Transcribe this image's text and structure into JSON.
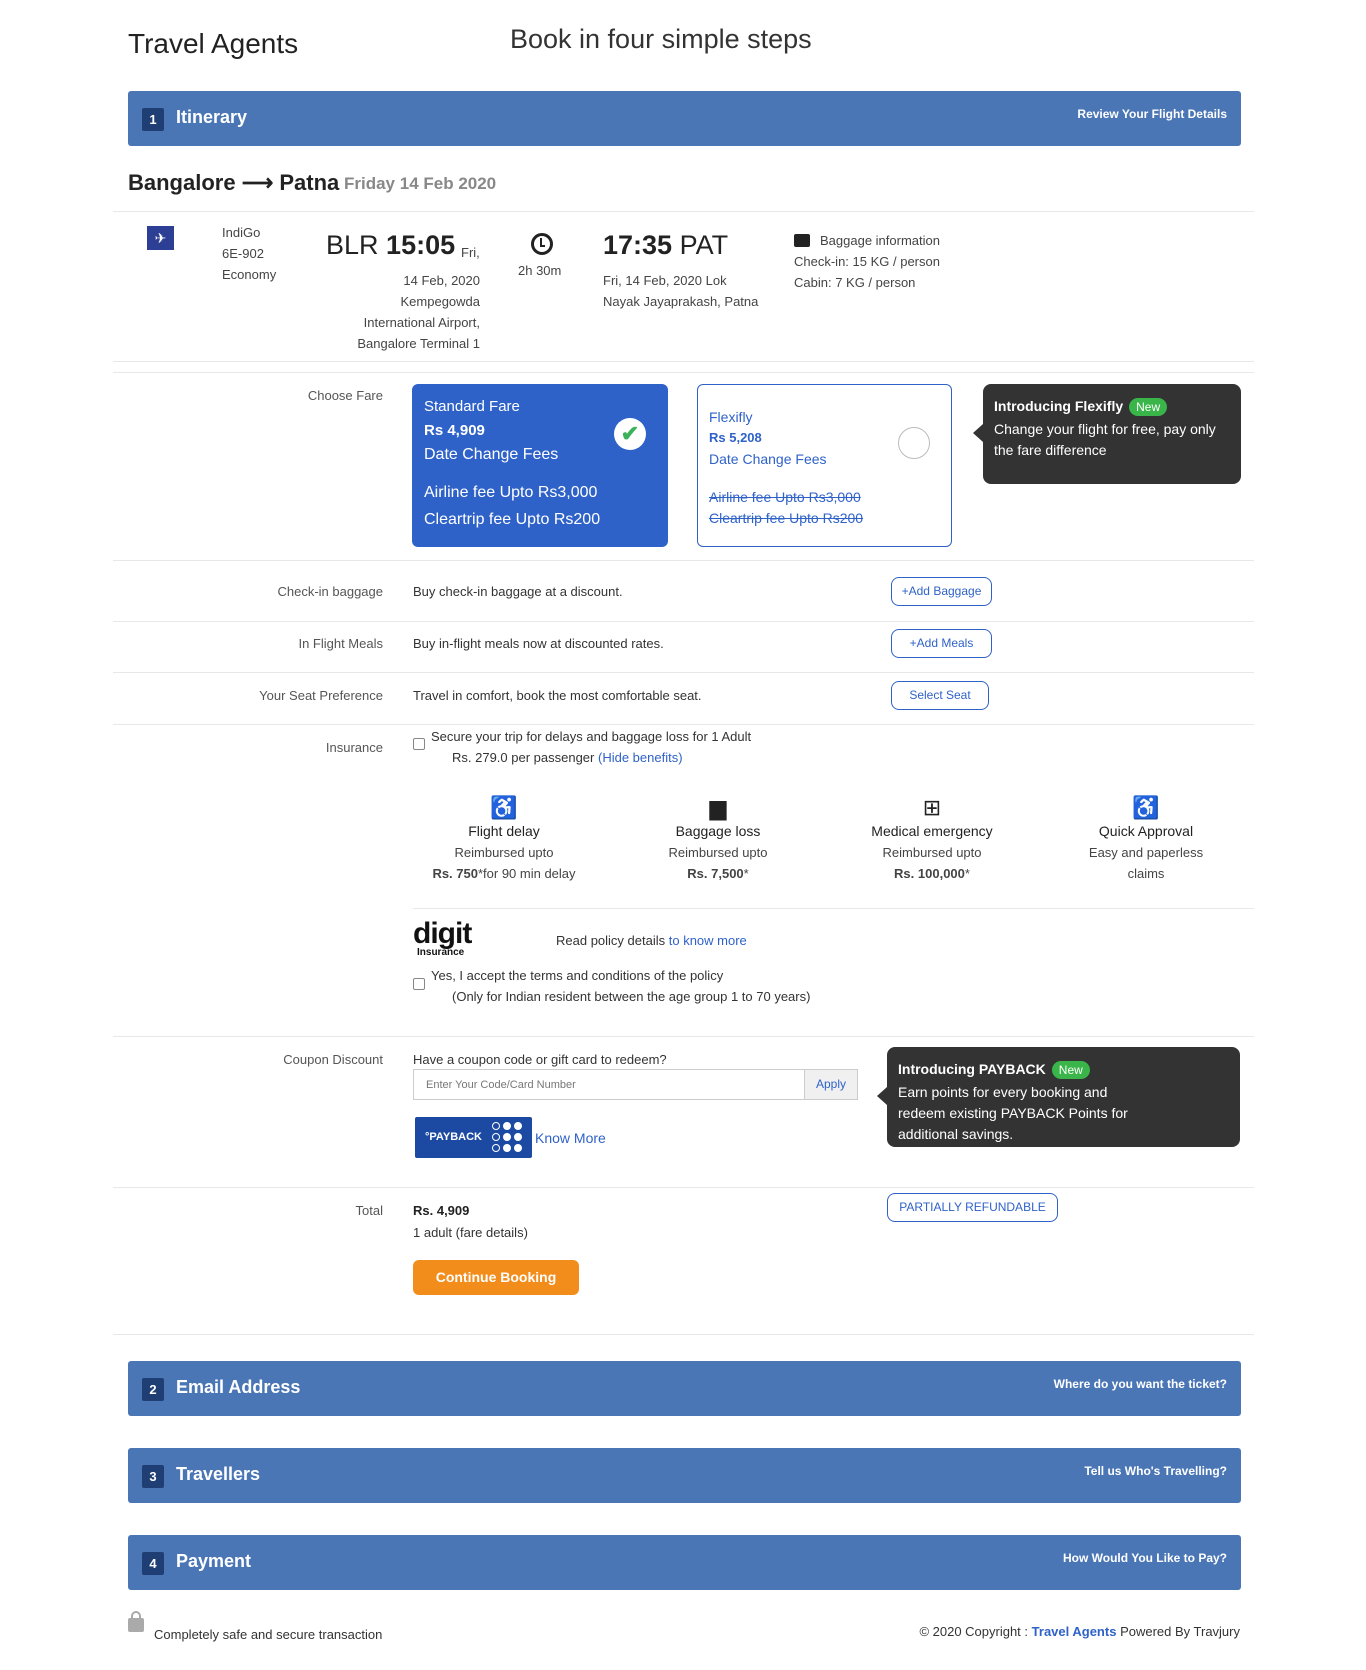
{
  "header": {
    "logo": "Travel Agents",
    "tagline": "Book in four simple steps"
  },
  "steps": [
    {
      "num": "1",
      "title": "Itinerary",
      "sub": "Review Your Flight Details"
    },
    {
      "num": "2",
      "title": "Email Address",
      "sub": "Where do you want the ticket?"
    },
    {
      "num": "3",
      "title": "Travellers",
      "sub": "Tell us Who's Travelling?"
    },
    {
      "num": "4",
      "title": "Payment",
      "sub": "How Would You Like to Pay?"
    }
  ],
  "itinerary": {
    "route": "Bangalore ⟶ Patna",
    "date": "Friday 14 Feb 2020",
    "airline": "IndiGo",
    "flight_no": "6E-902",
    "cabin": "Economy",
    "dep_code": "BLR",
    "dep_time": "15:05",
    "dep_day": "Fri,",
    "dep_detail_1": "14 Feb, 2020",
    "dep_detail_2": "Kempegowda",
    "dep_detail_3": "International Airport,",
    "dep_detail_4": "Bangalore Terminal 1",
    "duration": "2h 30m",
    "arr_time": "17:35",
    "arr_code": "PAT",
    "arr_detail_1": "Fri, 14 Feb, 2020 Lok",
    "arr_detail_2": "Nayak Jayaprakash, Patna",
    "baggage_title": "Baggage information",
    "checkin": "Check-in: 15 KG / person",
    "cabin_bag": "Cabin: 7 KG / person"
  },
  "fare": {
    "label": "Choose Fare",
    "standard": {
      "name": "Standard Fare",
      "price": "Rs 4,909",
      "desc": "Date Change Fees",
      "airline_fee": "Airline fee Upto Rs3,000",
      "cleartrip_fee": "Cleartrip fee Upto Rs200"
    },
    "flexifly": {
      "name": "Flexifly",
      "price": "Rs 5,208",
      "desc": "Date Change Fees",
      "airline_fee": "Airline fee Upto Rs3,000",
      "cleartrip_fee": "Cleartrip fee Upto Rs200"
    },
    "tip_title": "Introducing Flexifly",
    "tip_badge": "New",
    "tip_text": "Change your flight for free, pay only the fare difference"
  },
  "addons": {
    "baggage_label": "Check-in baggage",
    "baggage_text": "Buy check-in baggage at a discount.",
    "baggage_btn": "+Add Baggage",
    "meals_label": "In Flight Meals",
    "meals_text": "Buy in-flight meals now at discounted rates.",
    "meals_btn": "+Add Meals",
    "seat_label": "Your Seat Preference",
    "seat_text": "Travel in comfort, book the most comfortable seat.",
    "seat_btn": "Select Seat"
  },
  "insurance": {
    "label": "Insurance",
    "line1": "Secure your trip for delays and baggage loss for 1 Adult",
    "line2": "Rs. 279.0 per passenger",
    "hide_link": "(Hide benefits)",
    "benefits": [
      {
        "icon": "wheelchair-icon",
        "title": "Flight delay",
        "l1": "Reimbursed upto",
        "l2b": "Rs. 750",
        "l2": "*for 90 min delay"
      },
      {
        "icon": "suitcase-icon",
        "title": "Baggage loss",
        "l1": "Reimbursed upto",
        "l2b": "Rs. 7,500",
        "l2": "*"
      },
      {
        "icon": "medical-kit-icon",
        "title": "Medical emergency",
        "l1": "Reimbursed upto",
        "l2b": "Rs. 100,000",
        "l2": "*"
      },
      {
        "icon": "wheelchair-icon",
        "title": "Quick Approval",
        "l1": "Easy and paperless",
        "l2b": "",
        "l2": "claims"
      }
    ],
    "brand": "digit",
    "brand_sub": "Insurance",
    "policy_text": "Read policy details",
    "policy_link": "to know more",
    "accept_1": "Yes, I accept the terms and conditions of the policy",
    "accept_2": "(Only for Indian resident between the age group 1 to 70 years)"
  },
  "coupon": {
    "label": "Coupon Discount",
    "prompt": "Have a coupon code or gift card to redeem?",
    "placeholder": "Enter Your Code/Card Number",
    "apply": "Apply",
    "payback_logo": "°PAYBACK",
    "know_more": "Know More",
    "tip_title": "Introducing PAYBACK",
    "tip_badge": "New",
    "tip_text": "Earn points for every booking and redeem existing PAYBACK Points for additional savings."
  },
  "total": {
    "label": "Total",
    "amount": "Rs. 4,909",
    "detail": "1 adult (fare details)",
    "refund_badge": "PARTIALLY REFUNDABLE",
    "continue": "Continue Booking"
  },
  "footer": {
    "secure": "Completely safe and secure transaction",
    "copyright_prefix": "© 2020 Copyright :",
    "brand": "Travel Agents",
    "powered": "Powered By Travjury"
  },
  "colors": {
    "step_bar": "#4a76b6",
    "accent": "#2f62c8",
    "continue": "#f28c1b",
    "new_badge": "#3ab54a"
  }
}
